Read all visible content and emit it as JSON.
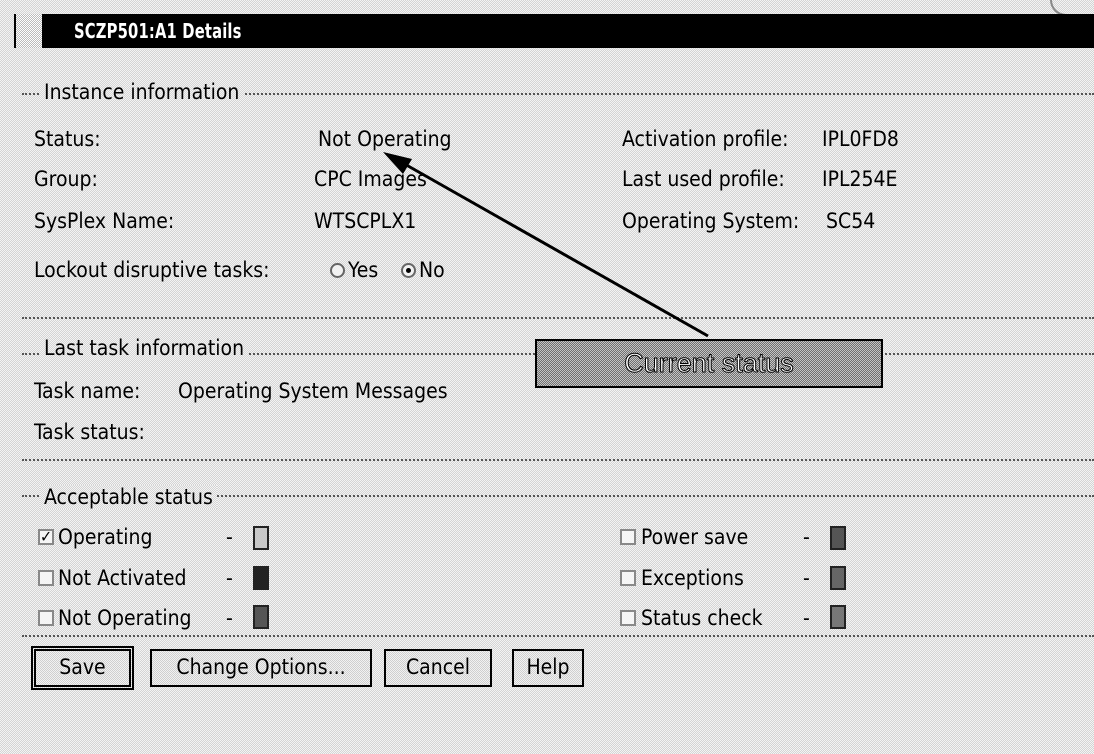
{
  "window": {
    "title": "SCZP501:A1 Details"
  },
  "instance": {
    "legend": "Instance information",
    "status_label": "Status:",
    "status_value": "Not Operating",
    "group_label": "Group:",
    "group_value": "CPC Images",
    "sysplex_label": "SysPlex Name:",
    "sysplex_value": "WTSCPLX1",
    "activation_label": "Activation profile:",
    "activation_value": "IPL0FD8",
    "lastused_label": "Last used profile:",
    "lastused_value": "IPL254E",
    "os_label": "Operating System:",
    "os_value": "SC54",
    "lockout_label": "Lockout disruptive tasks:",
    "lockout_yes": "Yes",
    "lockout_no": "No",
    "lockout_selected": "No"
  },
  "lasttask": {
    "legend": "Last task information",
    "name_label": "Task name:",
    "name_value": "Operating System Messages",
    "status_label": "Task status:"
  },
  "callout": {
    "text": "Current status"
  },
  "acceptable": {
    "legend": "Acceptable status",
    "dash": "-",
    "items": [
      {
        "label": "Operating",
        "checked": true,
        "color": "#c8c8c8"
      },
      {
        "label": "Not Activated",
        "checked": false,
        "color": "#222222"
      },
      {
        "label": "Not Operating",
        "checked": false,
        "color": "#555555"
      },
      {
        "label": "Power save",
        "checked": false,
        "color": "#555555"
      },
      {
        "label": "Exceptions",
        "checked": false,
        "color": "#666666"
      },
      {
        "label": "Status check",
        "checked": false,
        "color": "#777777"
      }
    ]
  },
  "buttons": {
    "save": "Save",
    "change_options": "Change Options...",
    "cancel": "Cancel",
    "help": "Help"
  }
}
